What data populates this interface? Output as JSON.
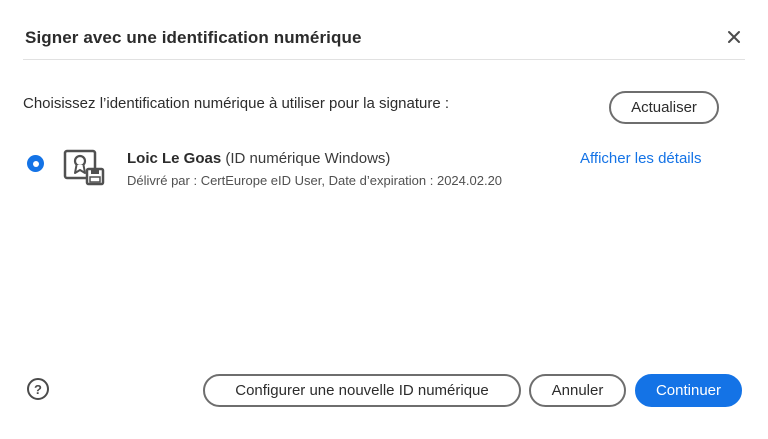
{
  "dialog": {
    "title": "Signer avec une identification numérique",
    "close_icon": "close-icon",
    "prompt": "Choisissez l’identification numérique à utiliser pour la signature :",
    "refresh_label": "Actualiser"
  },
  "identities": [
    {
      "selected": true,
      "icon": "certificate-icon",
      "name": "Loic Le Goas",
      "type": "(ID numérique Windows)",
      "detail": "Délivré par : CertEurope eID User, Date d’expiration : 2024.02.20",
      "details_link": "Afficher les détails"
    }
  ],
  "footer": {
    "help_icon": "help-icon",
    "help_symbol": "?",
    "configure_label": "Configurer une nouvelle ID numérique",
    "cancel_label": "Annuler",
    "continue_label": "Continuer"
  },
  "colors": {
    "accent": "#1473e6",
    "text": "#2c2c2c",
    "border": "#6e6e6e"
  }
}
